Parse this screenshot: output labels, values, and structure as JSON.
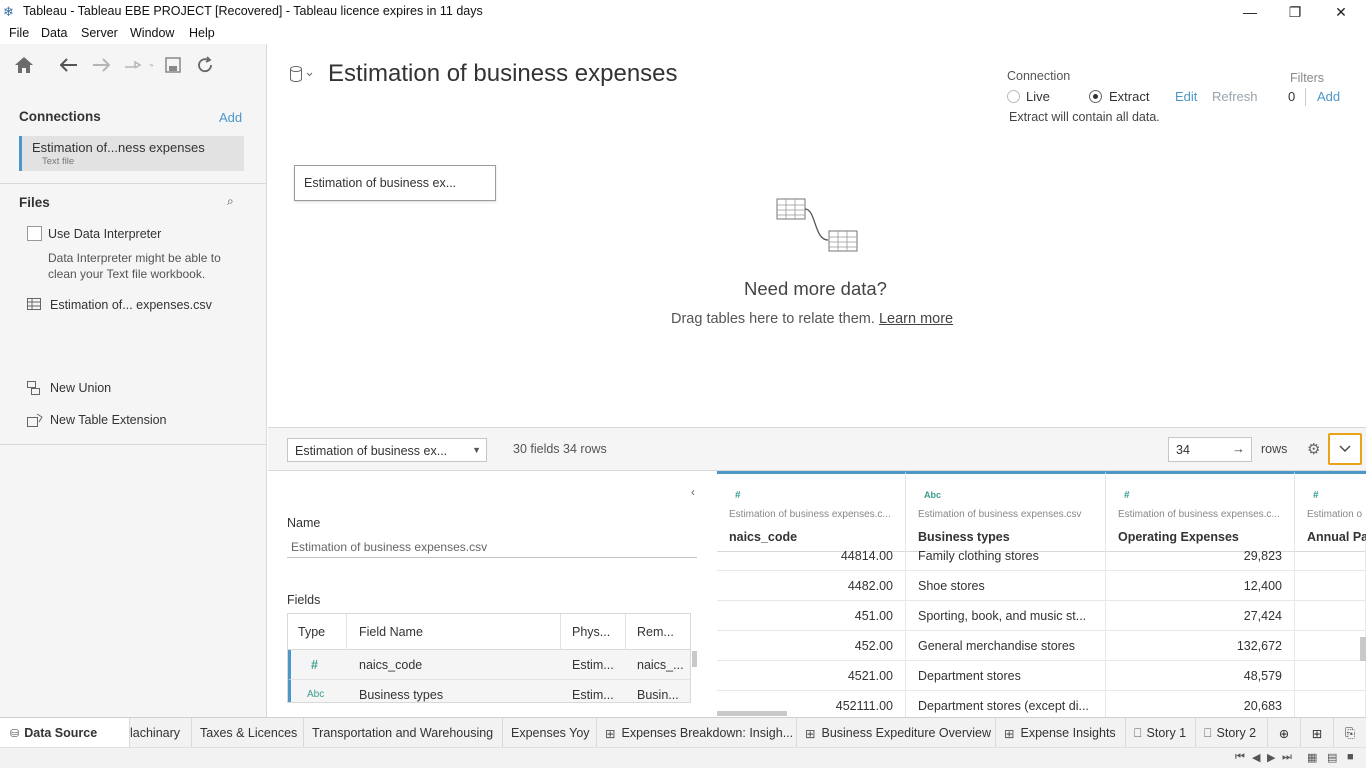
{
  "window": {
    "title": "Tableau - Tableau EBE PROJECT [Recovered] - Tableau licence expires in 11 days",
    "minimize": "—",
    "restore": "❐",
    "close": "✕"
  },
  "menu": [
    "File",
    "Data",
    "Server",
    "Window",
    "Help"
  ],
  "left_pane": {
    "connections_title": "Connections",
    "connections_add": "Add",
    "connection_name": "Estimation of...ness expenses",
    "connection_type": "Text file",
    "files_title": "Files",
    "use_data_interpreter": "Use Data Interpreter",
    "interpreter_note_1": "Data Interpreter might be able to",
    "interpreter_note_2": "clean your Text file workbook.",
    "file_name": "Estimation of... expenses.csv",
    "new_union": "New Union",
    "new_table_extension": "New Table Extension"
  },
  "canvas": {
    "datasource_title": "Estimation of business expenses",
    "connection_label": "Connection",
    "live_label": "Live",
    "extract_label": "Extract",
    "edit_label": "Edit",
    "refresh_label": "Refresh",
    "extract_note": "Extract will contain all data.",
    "filters_label": "Filters",
    "filters_count": "0",
    "filters_add": "Add",
    "table_pill": "Estimation of business ex...",
    "need_more_data": "Need more data?",
    "drag_hint": "Drag tables here to relate them.",
    "learn_more": "Learn more"
  },
  "grid_toolbar": {
    "table_select": "Estimation of business ex...",
    "summary": "30 fields 34 rows",
    "rows_value": "34",
    "rows_label": "rows"
  },
  "metadata": {
    "name_label": "Name",
    "name_value": "Estimation of business expenses.csv",
    "fields_label": "Fields",
    "columns": [
      "Type",
      "Field Name",
      "Phys...",
      "Rem..."
    ],
    "rows": [
      {
        "type": "#",
        "field": "naics_code",
        "phys": "Estim...",
        "remote": "naics_..."
      },
      {
        "type": "Abc",
        "field": "Business types",
        "phys": "Estim...",
        "remote": "Busin..."
      }
    ]
  },
  "grid": {
    "columns": [
      {
        "type": "#",
        "source": "Estimation of business expenses.c...",
        "name": "naics_code"
      },
      {
        "type": "Abc",
        "source": "Estimation of business expenses.csv",
        "name": "Business types"
      },
      {
        "type": "#",
        "source": "Estimation of business expenses.c...",
        "name": "Operating Expenses"
      },
      {
        "type": "#",
        "source": "Estimation o",
        "name": "Annual Pa"
      }
    ],
    "rows": [
      [
        "44814.00",
        "Family clothing stores",
        "29,823"
      ],
      [
        "4482.00",
        "Shoe stores",
        "12,400"
      ],
      [
        "451.00",
        "Sporting, book, and  music st...",
        "27,424"
      ],
      [
        "452.00",
        "General merchandise stores",
        "132,672"
      ],
      [
        "4521.00",
        "Department stores",
        "48,579"
      ],
      [
        "452111.00",
        "Department stores (except di...",
        "20,683"
      ]
    ]
  },
  "tabs": {
    "data_source": "Data Source",
    "sheets": [
      "lachinary",
      "Taxes & Licences",
      "Transportation and Warehousing",
      "Expenses Yoy",
      "Expenses Breakdown: Insigh...",
      "Business Expediture Overview",
      "Expense Insights",
      "Story 1",
      "Story 2"
    ]
  },
  "colors": {
    "accent": "#4c97c8",
    "highlight": "#e8a317",
    "teal": "#3a9d8f"
  }
}
